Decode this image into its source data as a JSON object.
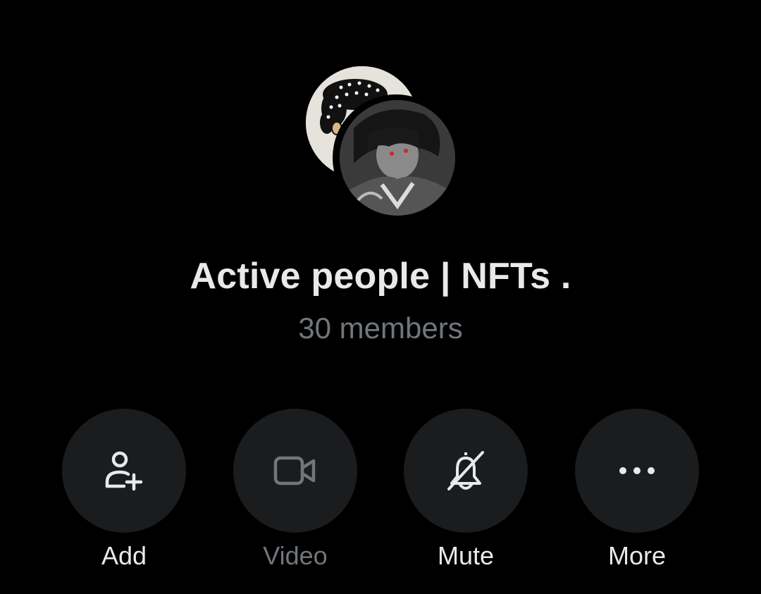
{
  "group": {
    "name": "Active people | NFTs .",
    "members": "30 members"
  },
  "actions": [
    {
      "label": "Add",
      "icon": "add-person-icon",
      "enabled": true
    },
    {
      "label": "Video",
      "icon": "video-camera-icon",
      "enabled": false
    },
    {
      "label": "Mute",
      "icon": "bell-off-icon",
      "enabled": true
    },
    {
      "label": "More",
      "icon": "more-dots-icon",
      "enabled": true
    }
  ],
  "colors": {
    "background": "#000000",
    "primary_text": "#e7e9ea",
    "secondary_text": "#71767b",
    "button_bg": "#1b1c1e"
  }
}
